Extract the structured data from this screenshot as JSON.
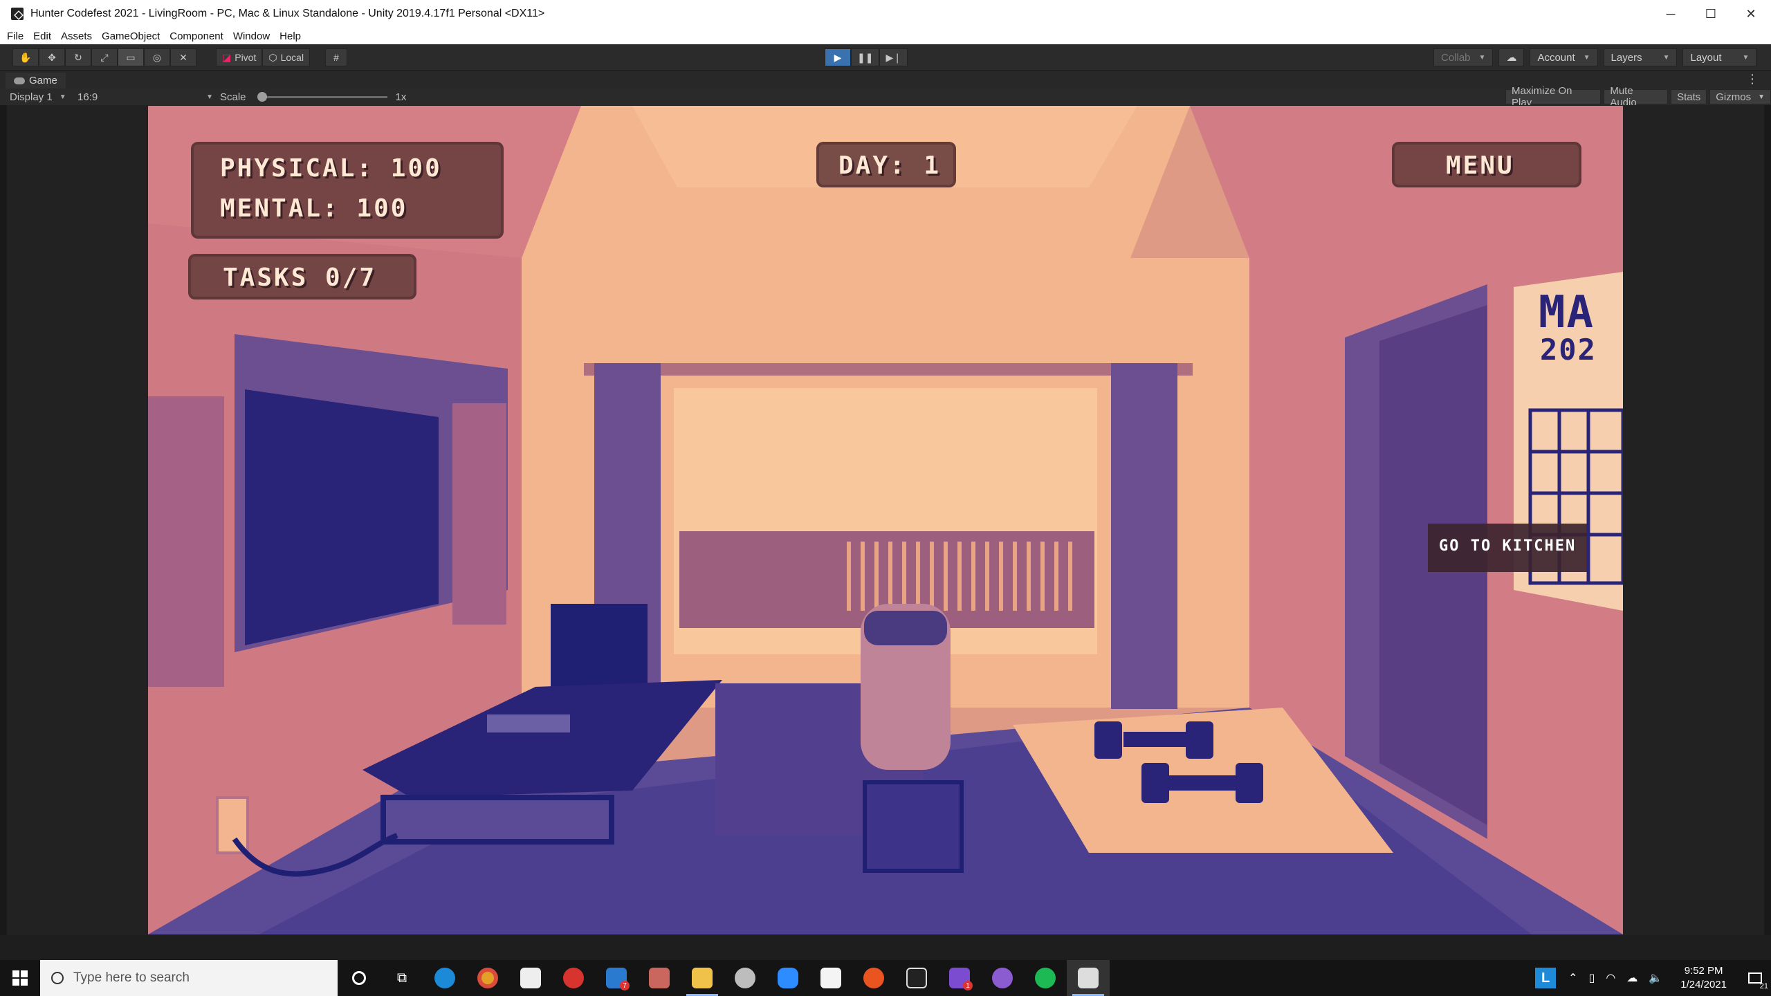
{
  "window": {
    "title": "Hunter Codefest 2021 - LivingRoom - PC, Mac & Linux Standalone - Unity 2019.4.17f1 Personal <DX11>",
    "controls": {
      "minimize": "─",
      "maximize": "☐",
      "close": "✕"
    }
  },
  "menu": [
    "File",
    "Edit",
    "Assets",
    "GameObject",
    "Component",
    "Window",
    "Help"
  ],
  "toolbar": {
    "tools": [
      "hand-tool",
      "move-tool",
      "rotate-tool",
      "scale-tool",
      "rect-tool",
      "transform-tool",
      "custom-tool"
    ],
    "pivot_label": "Pivot",
    "local_label": "Local",
    "collab_label": "Collab",
    "account_label": "Account",
    "layers_label": "Layers",
    "layout_label": "Layout"
  },
  "game_tab": {
    "label": "Game"
  },
  "game_bar": {
    "display": "Display 1",
    "aspect": "16:9",
    "scale_label": "Scale",
    "scale_value": "1x",
    "maximize_on_play": "Maximize On Play",
    "mute_audio": "Mute Audio",
    "stats": "Stats",
    "gizmos": "Gizmos"
  },
  "game": {
    "physical_label": "PHYSICAL: 100",
    "mental_label": "MENTAL: 100",
    "tasks_label": "TASKS 0/7",
    "day_label": "DAY: 1",
    "menu_label": "MENU",
    "go_kitchen_label": "GO TO KITCHEN",
    "calendar_text_1": "MA",
    "calendar_text_2": "202",
    "colors": {
      "wall_light": "#f3b58e",
      "wall_mid": "#df9a85",
      "wall_pink": "#d07a85",
      "floor": "#5b4a96",
      "floor_dark": "#3d3489",
      "furniture_dark": "#1f1f73",
      "panel": "#683e3c",
      "text": "#ffe8d4"
    }
  },
  "taskbar": {
    "search_placeholder": "Type here to search",
    "apps": [
      "cortana",
      "task-view",
      "edge",
      "chrome",
      "store",
      "app-red",
      "mail",
      "game-app",
      "file-explorer",
      "cloud-app",
      "zoom",
      "notepad-app",
      "ubuntu",
      "terminal",
      "discord-app",
      "github-desktop",
      "spotify",
      "unity"
    ],
    "mail_badge": "7",
    "discord_badge": "1",
    "time": "9:52 PM",
    "date": "1/24/2021",
    "notifications_badge": "21",
    "tray_app": "L"
  }
}
